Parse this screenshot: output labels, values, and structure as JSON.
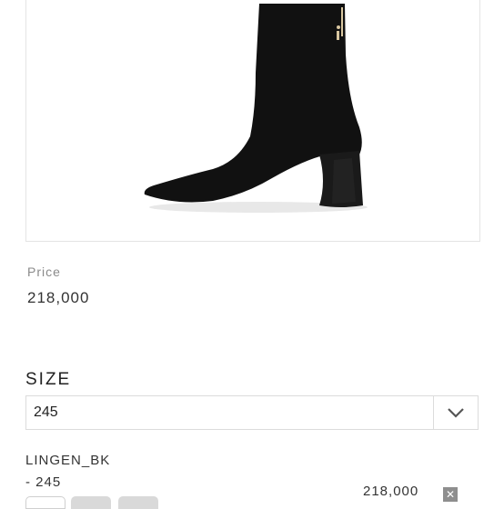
{
  "product": {
    "image_alt": "black sock ankle boot with block heel",
    "price_label": "Price",
    "price_value": "218,000"
  },
  "size": {
    "heading": "SIZE",
    "selected": "245"
  },
  "selected_option": {
    "name": "LINGEN_BK",
    "size": "- 245",
    "price": "218,000",
    "remove_symbol": "✕"
  },
  "colors": {
    "border": "#dcdcdc",
    "label_gray": "#8a8a8a",
    "remove_bg": "#8e8e8e"
  }
}
